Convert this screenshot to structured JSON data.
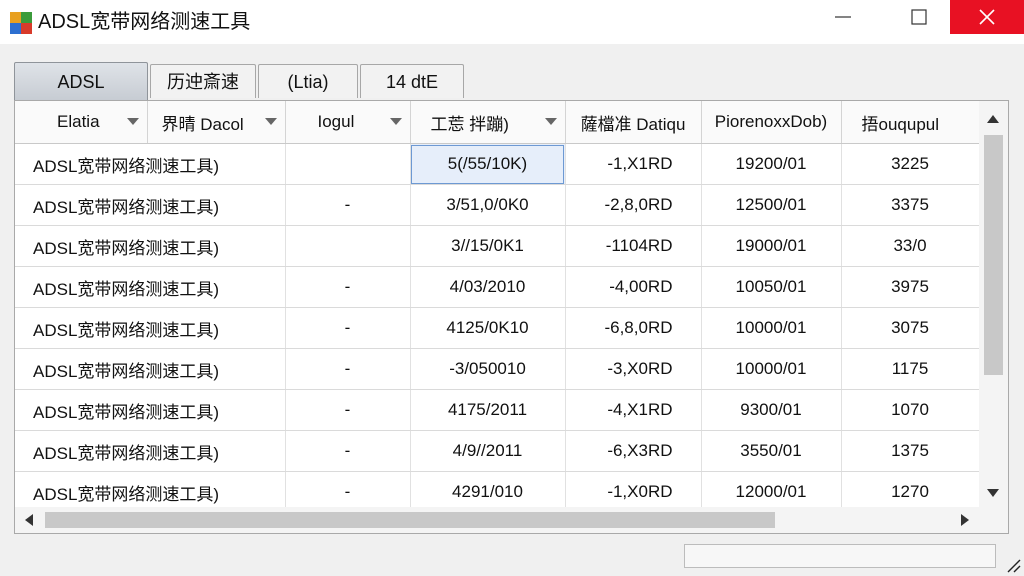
{
  "window": {
    "title": "ADSL宽带网络测速工具",
    "accent_close": "#e81123"
  },
  "tabs": [
    {
      "label": "ADSL",
      "active": true
    },
    {
      "label": "历迚斎速",
      "active": false
    },
    {
      "label": "(Ltia)",
      "active": false
    },
    {
      "label": "14 dtE",
      "active": false
    }
  ],
  "table": {
    "columns": [
      "Elatia",
      "界晴 Dacol",
      "Iogul",
      "工莣 拌蹦)",
      "薩檔准 Datiqu",
      "Piorenoxx­Dob)",
      "捂ouqupul"
    ],
    "rows": [
      [
        "ADSL宽带网络测速工具)",
        "",
        "5(/55/10K)",
        "-1,X1RD",
        "19200/01",
        "3225"
      ],
      [
        "ADSL宽带网络测速工具)",
        "-",
        "3/51,0/0K0",
        "-2,8,0RD",
        "12500/01",
        "3375"
      ],
      [
        "ADSL宽带网络测速工具)",
        "",
        "3//15/0K1",
        "-1104RD",
        "19000/01",
        "33/0"
      ],
      [
        "ADSL宽带网络测速工具)",
        "-",
        "4/03/2010",
        "-4,00RD",
        "10050/01",
        "3975"
      ],
      [
        "ADSL宽带网络测速工具)",
        "-",
        "4125/0K10",
        "-6,8,0RD",
        "10000/01",
        "3075"
      ],
      [
        "ADSL宽带网络测速工具)",
        "-",
        "-3/050010",
        "-3,X0RD",
        "10000/01",
        "1175"
      ],
      [
        "ADSL宽带网络测速工具)",
        "-",
        "4175/2011",
        "-4,X1RD",
        "9300/01",
        "1070"
      ],
      [
        "ADSL宽带网络测速工具)",
        "-",
        "4/9//2011",
        "-6,X3RD",
        "3550/01",
        "1375"
      ],
      [
        "ADSL宽带网络测速工具)",
        "-",
        "4291/010",
        "-1,X0RD",
        "12000/01",
        "1270"
      ]
    ]
  },
  "icons": {
    "app": "app-logo-icon",
    "minimize": "minimize-icon",
    "maximize": "maximize-icon",
    "close": "close-icon",
    "grip": "resize-grip-icon"
  }
}
